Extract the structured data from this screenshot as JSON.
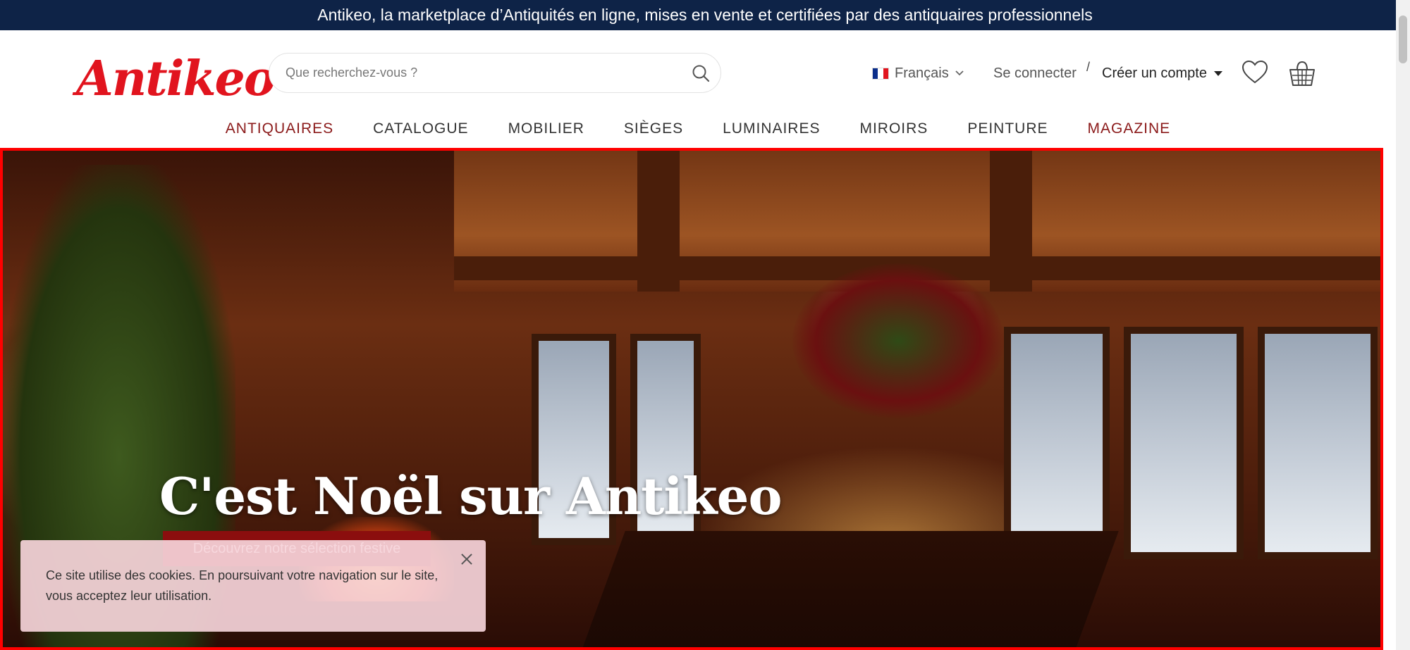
{
  "topbar": {
    "text": "Antikeo, la marketplace d’Antiquités en ligne, mises en vente et certifiées par des antiquaires professionnels"
  },
  "header": {
    "logo_text": "Antikeo",
    "search_placeholder": "Que recherchez-vous ?",
    "language": "Français",
    "login_label": "Se connecter",
    "separator": "/",
    "create_account_label": "Créer un compte",
    "icons": [
      "search-icon",
      "flag-fr-icon",
      "chevron-down-icon",
      "caret-down-icon",
      "heart-icon",
      "basket-icon"
    ]
  },
  "nav": {
    "items": [
      {
        "label": "ANTIQUAIRES",
        "accent": true
      },
      {
        "label": "CATALOGUE",
        "accent": false
      },
      {
        "label": "MOBILIER",
        "accent": false
      },
      {
        "label": "SIÈGES",
        "accent": false
      },
      {
        "label": "LUMINAIRES",
        "accent": false
      },
      {
        "label": "MIROIRS",
        "accent": false
      },
      {
        "label": "PEINTURE",
        "accent": false
      },
      {
        "label": "MAGAZINE",
        "accent": true
      }
    ]
  },
  "hero": {
    "title": "C'est Noël sur Antikeo",
    "cta_label": "Découvrez notre sélection festive"
  },
  "cookie": {
    "text": "Ce site utilise des cookies. En poursuivant votre navigation sur le site, vous acceptez leur utilisation."
  },
  "colors": {
    "topbar_bg": "#0e2347",
    "logo_red": "#e1141e",
    "nav_accent": "#8b1a1a",
    "cta_bg": "#8b0e0e",
    "hero_border": "#ff0000",
    "cookie_bg": "#f6d4da"
  }
}
